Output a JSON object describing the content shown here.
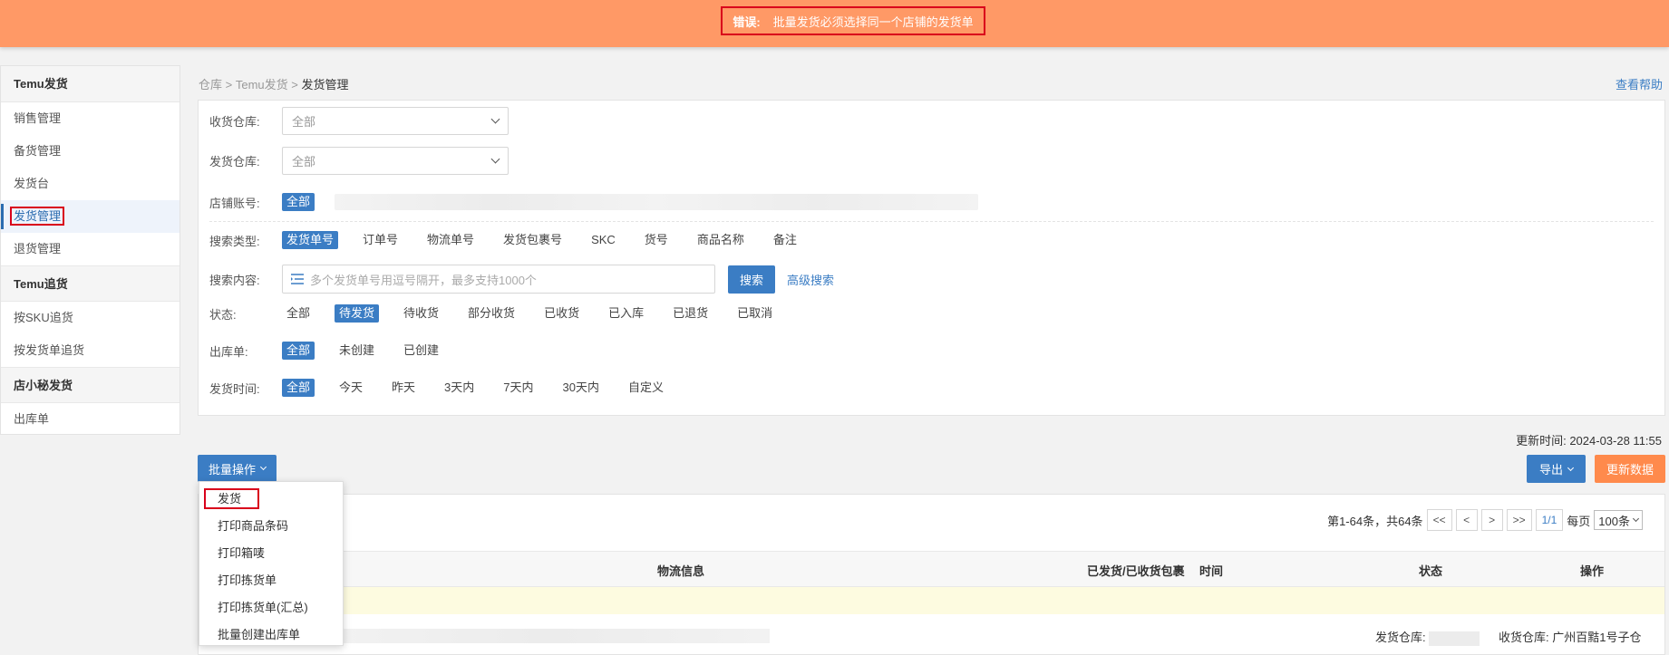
{
  "banner": {
    "label": "错误:",
    "message": "批量发货必须选择同一个店铺的发货单"
  },
  "sidebar": {
    "groups": [
      {
        "title": "Temu发货",
        "items": [
          "销售管理",
          "备货管理",
          "发货台",
          "发货管理",
          "退货管理"
        ]
      },
      {
        "title": "Temu追货",
        "items": [
          "按SKU追货",
          "按发货单追货"
        ]
      },
      {
        "title": "店小秘发货",
        "items": [
          "出库单"
        ]
      }
    ],
    "active": "发货管理"
  },
  "breadcrumb": {
    "a": "仓库",
    "sep": ">",
    "b": "Temu发货",
    "c": "发货管理"
  },
  "help": "查看帮助",
  "filters": {
    "recv_wh": {
      "label": "收货仓库:",
      "value": "全部"
    },
    "send_wh": {
      "label": "发货仓库:",
      "value": "全部"
    },
    "shop": {
      "label": "店铺账号:",
      "all": "全部"
    },
    "search_type": {
      "label": "搜索类型:",
      "options": [
        "发货单号",
        "订单号",
        "物流单号",
        "发货包裹号",
        "SKC",
        "货号",
        "商品名称",
        "备注"
      ]
    },
    "search_content": {
      "label": "搜索内容:",
      "placeholder": "多个发货单号用逗号隔开，最多支持1000个",
      "search": "搜索",
      "advanced": "高级搜索"
    },
    "status": {
      "label": "状态:",
      "options": [
        "全部",
        "待发货",
        "待收货",
        "部分收货",
        "已收货",
        "已入库",
        "已退货",
        "已取消"
      ]
    },
    "outbound": {
      "label": "出库单:",
      "options": [
        "全部",
        "未创建",
        "已创建"
      ]
    },
    "ship_time": {
      "label": "发货时间:",
      "options": [
        "全部",
        "今天",
        "昨天",
        "3天内",
        "7天内",
        "30天内",
        "自定义"
      ]
    }
  },
  "toolbar": {
    "update_time": "更新时间: 2024-03-28 11:55",
    "bulk": "批量操作",
    "export": "导出",
    "refresh": "更新数据"
  },
  "menu": [
    "发货",
    "打印商品条码",
    "打印箱唛",
    "打印拣货单",
    "打印拣货单(汇总)",
    "批量创建出库单"
  ],
  "pager": {
    "summary": "第1-64条，共64条",
    "first": "<<",
    "prev": "<",
    "next": ">",
    "last": ">>",
    "page": "1/1",
    "per_label": "每页",
    "per": "100条"
  },
  "table": {
    "cols": [
      "物流信息",
      "已发货/已收货包裹",
      "时间",
      "状态",
      "操作"
    ],
    "row": {
      "send_wh": "发货仓库:",
      "recv_wh": "收货仓库: 广州百黠1号子仓"
    }
  },
  "colors": {
    "banner": "#ff9966",
    "primary": "#3b7dc4",
    "orange": "#ff8a4c",
    "highlight": "#d9001b"
  }
}
